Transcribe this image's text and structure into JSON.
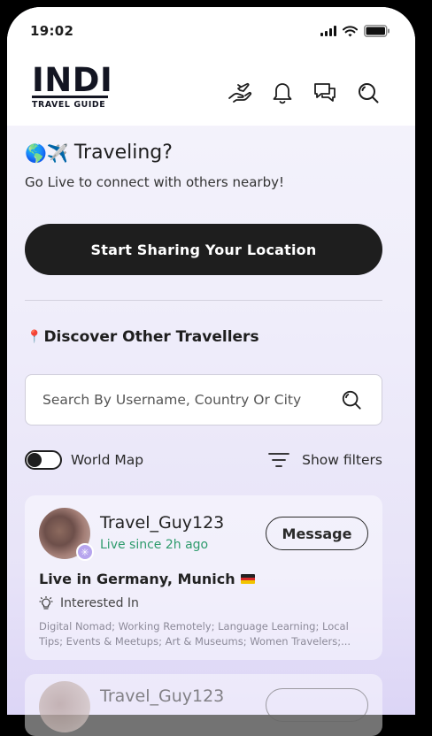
{
  "status": {
    "time": "19:02"
  },
  "logo": {
    "main": "INDI",
    "sub": "TRAVEL GUIDE"
  },
  "nav": {
    "icons": [
      "hand-plane-icon",
      "bell-icon",
      "chat-icon",
      "search-icon"
    ]
  },
  "traveling": {
    "emoji": "🌎✈️",
    "title": "Traveling?",
    "subtitle": "Go Live to connect with others nearby!",
    "share_label": "Start Sharing Your Location"
  },
  "discover": {
    "pin": "📍",
    "title": "Discover Other Travellers",
    "search_placeholder": "Search By Username, Country Or City"
  },
  "map_toggle": {
    "label": "World Map",
    "on": false
  },
  "filters": {
    "label": "Show filters"
  },
  "cards": [
    {
      "username": "Travel_Guy123",
      "live_since": "Live since 2h ago",
      "message_label": "Message",
      "live_in": "Live in Germany, Munich",
      "interested_label": "Interested In",
      "interests": "Digital Nomad; Working Remotely; Language Learning; Local Tips; Events & Meetups; Art & Museums; Women Travelers;..."
    },
    {
      "username": "Travel_Guy123"
    }
  ],
  "colors": {
    "accent_dark": "#1e1e1e",
    "live_green": "#2e9b6c",
    "badge_purple": "#b7a5ee"
  }
}
